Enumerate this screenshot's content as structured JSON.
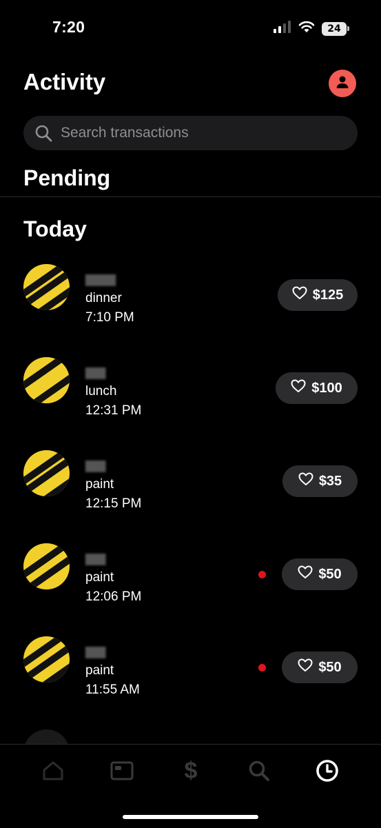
{
  "status_bar": {
    "time": "7:20",
    "battery": "24",
    "icons": [
      "cellular-signal-icon",
      "wifi-icon",
      "battery-icon"
    ]
  },
  "header": {
    "title": "Activity",
    "avatar_icon": "person-icon",
    "avatar_color": "#f25c54"
  },
  "search": {
    "placeholder": "Search transactions",
    "value": ""
  },
  "sections": {
    "pending": "Pending",
    "today": "Today"
  },
  "transactions": [
    {
      "note": "dinner",
      "time": "7:10 PM",
      "amount": "$125",
      "unread": false
    },
    {
      "note": "lunch",
      "time": "12:31 PM",
      "amount": "$100",
      "unread": false
    },
    {
      "note": "paint",
      "time": "12:15 PM",
      "amount": "$35",
      "unread": false
    },
    {
      "note": "paint",
      "time": "12:06 PM",
      "amount": "$50",
      "unread": true
    },
    {
      "note": "paint",
      "time": "11:55 AM",
      "amount": "$50",
      "unread": true
    }
  ],
  "tab_bar": {
    "tabs": [
      "home-icon",
      "card-icon",
      "dollar-icon",
      "search-icon",
      "activity-clock-icon"
    ],
    "active": "activity-clock-icon",
    "dollar_glyph": "$"
  },
  "colors": {
    "background": "#000000",
    "pill": "#2c2c2e",
    "unread_dot": "#e0141e",
    "avatar_yellow": "#f1d02c"
  }
}
